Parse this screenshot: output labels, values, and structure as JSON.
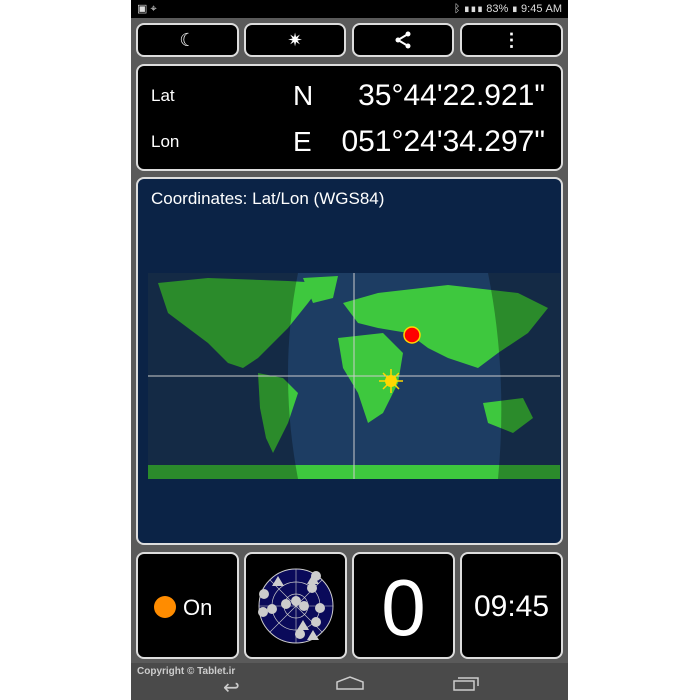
{
  "status_bar": {
    "battery": "83%",
    "time": "9:45 AM",
    "icons": [
      "image-icon",
      "gps-icon",
      "bluetooth-icon",
      "signal-icon",
      "battery-icon"
    ]
  },
  "toolbar": {
    "buttons": [
      {
        "icon": "night-mode-icon",
        "glyph": "☾"
      },
      {
        "icon": "compass-star-icon",
        "glyph": "✷"
      },
      {
        "icon": "share-icon",
        "glyph": "share"
      },
      {
        "icon": "more-vert-icon",
        "glyph": "⋮"
      }
    ]
  },
  "coords": {
    "lat_label": "Lat",
    "lat_hem": "N",
    "lat_value": "35°44'22.921\"",
    "lon_label": "Lon",
    "lon_hem": "E",
    "lon_value": "051°24'34.297\""
  },
  "map": {
    "title": "Coordinates: Lat/Lon (WGS84)",
    "land_color": "#3ec83e",
    "ocean_color": "#0b2346",
    "marker_color": "#ff0000",
    "sun_color": "#ffd700"
  },
  "tiles": {
    "gps_status": "On",
    "gps_status_color": "#ff8c00",
    "satellites_count": "0",
    "clock": "09:45"
  },
  "footer": {
    "copyright": "Copyright © Tablet.ir"
  },
  "nav": {
    "icons": [
      "back-icon",
      "home-icon",
      "recents-icon"
    ]
  }
}
